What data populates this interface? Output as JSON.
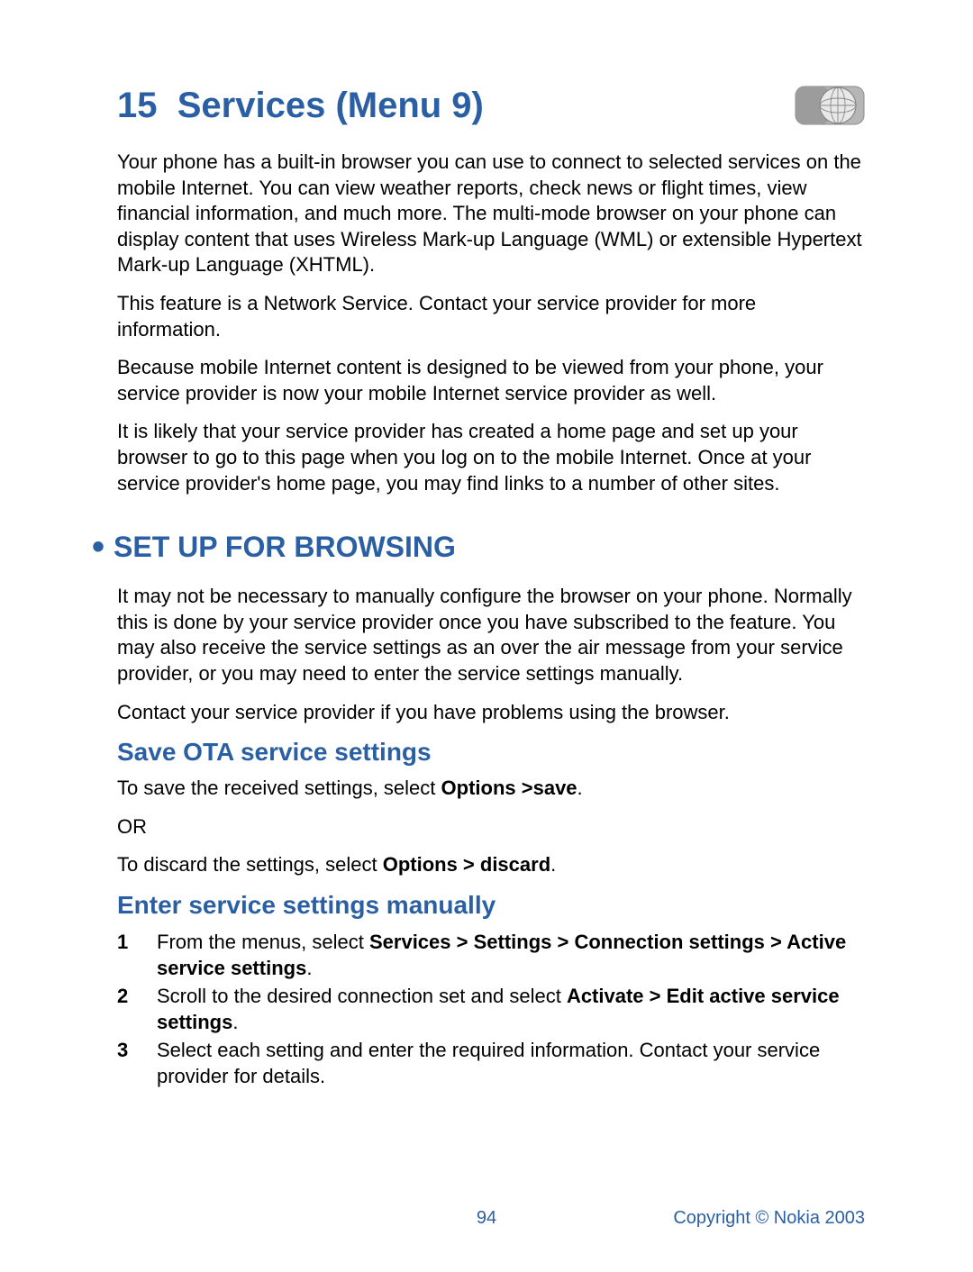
{
  "chapter": {
    "number": "15",
    "title": "Services (Menu 9)"
  },
  "intro": {
    "p1": "Your phone has a built-in browser you can use to connect to selected services on the mobile Internet. You can view weather reports, check news or flight times, view financial information, and much more. The multi-mode browser on your phone can display content that uses Wireless Mark-up Language (WML) or extensible Hypertext Mark-up Language (XHTML).",
    "p2": "This feature is a Network Service. Contact your service provider for more information.",
    "p3": "Because mobile Internet content is designed to be viewed from your phone, your service provider is now your mobile Internet service provider as well.",
    "p4": "It is likely that your service provider has created a home page and set up your browser to go to this page when you log on to the mobile Internet. Once at your service provider's home page, you may find links to a number of other sites."
  },
  "section1": {
    "heading": "SET UP FOR BROWSING",
    "p1": "It may not be necessary to manually configure the browser on your phone. Normally this is done by your service provider once you have subscribed to the feature. You may also receive the service settings as an over the air message from your service provider, or you may need to enter the service settings manually.",
    "p2": "Contact your service provider if you have problems using the browser."
  },
  "sub1": {
    "heading": "Save OTA service settings",
    "line1_pre": "To save the received settings, select ",
    "line1_bold": "Options >save",
    "line1_post": ".",
    "line2": "OR",
    "line3_pre": "To discard the settings, select ",
    "line3_bold": "Options > discard",
    "line3_post": "."
  },
  "sub2": {
    "heading": "Enter service settings manually",
    "steps": {
      "s1_pre": "From the menus, select ",
      "s1_bold": "Services > Settings > Connection settings > Active service settings",
      "s1_post": ".",
      "s2_pre": "Scroll to the desired connection set and select ",
      "s2_bold": "Activate > Edit active service settings",
      "s2_post": ".",
      "s3": "Select each setting and enter the required information. Contact your service provider for details."
    }
  },
  "footer": {
    "page": "94",
    "copyright": "Copyright © Nokia 2003"
  }
}
